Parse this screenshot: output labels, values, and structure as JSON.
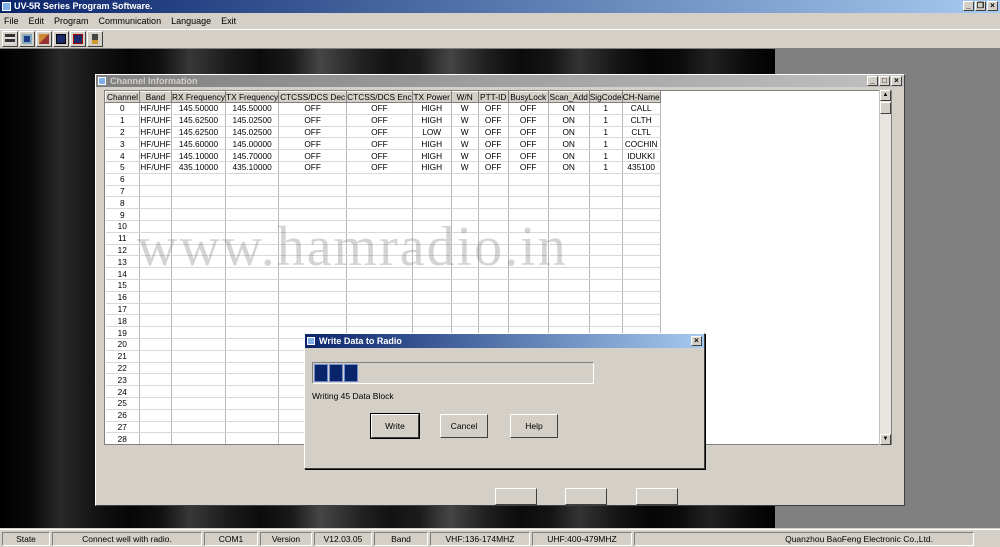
{
  "app": {
    "title": "UV-5R Series Program Software."
  },
  "menu": [
    "File",
    "Edit",
    "Program",
    "Communication",
    "Language",
    "Exit"
  ],
  "toolbar": {
    "icons": [
      "read-icon",
      "save-icon",
      "open-icon",
      "read-radio-icon",
      "write-radio-icon",
      "exit-icon"
    ]
  },
  "channel_window": {
    "title": "Channel Information",
    "columns": [
      "Channel",
      "Band",
      "RX Frequency",
      "TX Frequency",
      "CTCSS/DCS Dec",
      "CTCSS/DCS Enc",
      "TX Power",
      "W/N",
      "PTT-ID",
      "BusyLock",
      "Scan_Add",
      "SigCode",
      "CH-Name"
    ],
    "rows": [
      [
        "0",
        "HF/UHF",
        "145.50000",
        "145.50000",
        "OFF",
        "OFF",
        "HIGH",
        "W",
        "OFF",
        "OFF",
        "ON",
        "1",
        "CALL"
      ],
      [
        "1",
        "HF/UHF",
        "145.62500",
        "145.02500",
        "OFF",
        "OFF",
        "HIGH",
        "W",
        "OFF",
        "OFF",
        "ON",
        "1",
        "CLTH"
      ],
      [
        "2",
        "HF/UHF",
        "145.62500",
        "145.02500",
        "OFF",
        "OFF",
        "LOW",
        "W",
        "OFF",
        "OFF",
        "ON",
        "1",
        "CLTL"
      ],
      [
        "3",
        "HF/UHF",
        "145.60000",
        "145.00000",
        "OFF",
        "OFF",
        "HIGH",
        "W",
        "OFF",
        "OFF",
        "ON",
        "1",
        "COCHIN"
      ],
      [
        "4",
        "HF/UHF",
        "145.10000",
        "145.70000",
        "OFF",
        "OFF",
        "HIGH",
        "W",
        "OFF",
        "OFF",
        "ON",
        "1",
        "IDUKKI"
      ],
      [
        "5",
        "HF/UHF",
        "435.10000",
        "435.10000",
        "OFF",
        "OFF",
        "HIGH",
        "W",
        "OFF",
        "OFF",
        "ON",
        "1",
        "435100"
      ]
    ],
    "empty_channels": [
      "6",
      "7",
      "8",
      "9",
      "10",
      "11",
      "12",
      "13",
      "14",
      "15",
      "16",
      "17",
      "18",
      "19",
      "20",
      "21",
      "22",
      "23",
      "24",
      "25",
      "26",
      "27",
      "28"
    ],
    "watermark": "www.hamradio.in"
  },
  "dialog": {
    "title": "Write Data to Radio",
    "progress_blocks_filled": 3,
    "status": "Writing  45  Data Block",
    "buttons": {
      "write": "Write",
      "cancel": "Cancel",
      "help": "Help"
    }
  },
  "statusbar": {
    "state_label": "State",
    "state_value": "Connect well with radio.",
    "port": "COM1",
    "version_label": "Version",
    "version_value": "V12.03.05",
    "band_label": "Band",
    "vhf": "VHF:136-174MHZ",
    "uhf": "UHF:400-479MHZ",
    "company": "Quanzhou BaoFeng Electronic Co.,Ltd."
  }
}
